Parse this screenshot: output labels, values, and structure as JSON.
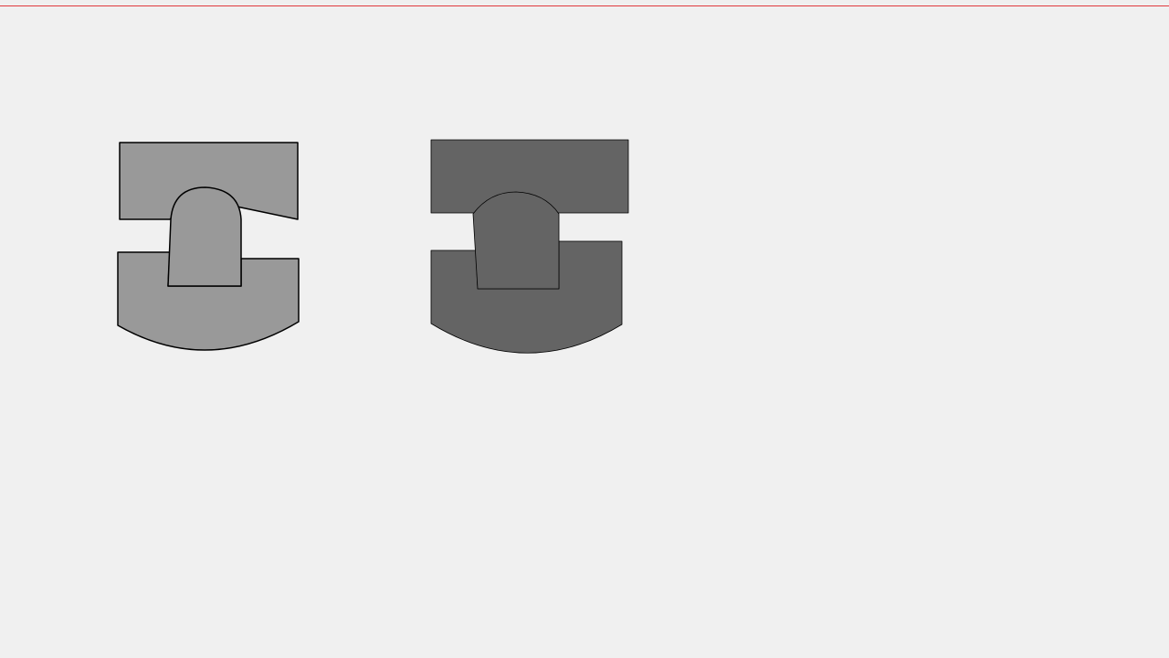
{
  "canvas": {
    "background_color": "#f0f0f0",
    "top_rule_color": "#e0393e"
  },
  "shapes": [
    {
      "name": "left-figure",
      "fill_color": "#999999",
      "stroke_color": "#000000",
      "parts": [
        "top-block",
        "bottom-block",
        "center-arch-piece"
      ]
    },
    {
      "name": "right-figure",
      "fill_color": "#646464",
      "stroke_color": "#000000",
      "parts": [
        "top-block",
        "bottom-block",
        "center-arch-piece"
      ]
    }
  ]
}
